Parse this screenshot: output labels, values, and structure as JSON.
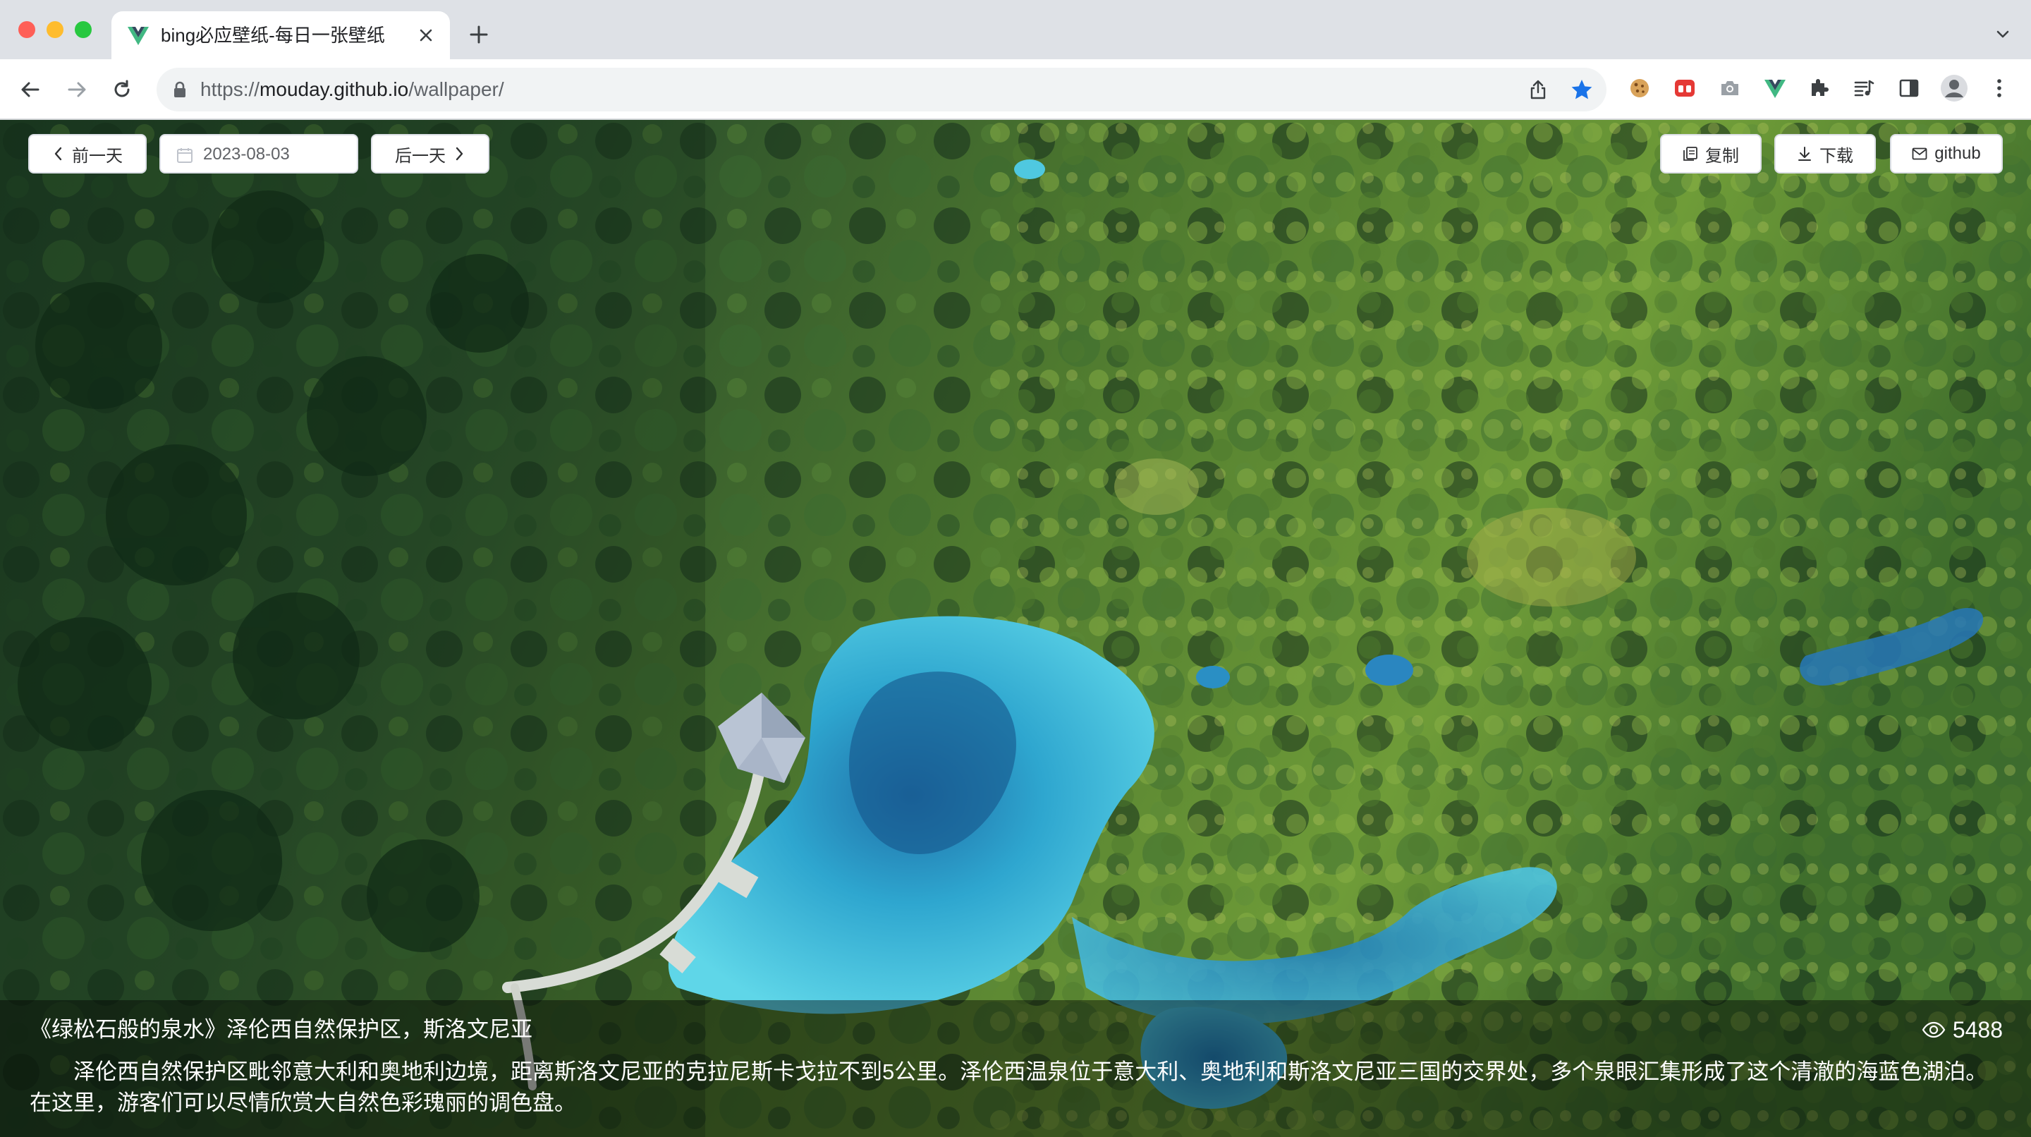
{
  "browser": {
    "tab_title": "bing必应壁纸-每日一张壁纸",
    "url_prefix": "https://",
    "url_host": "mouday.github.io",
    "url_path": "/wallpaper/"
  },
  "controls": {
    "prev_label": "前一天",
    "date_value": "2023-08-03",
    "next_label": "后一天",
    "copy_label": "复制",
    "download_label": "下载",
    "github_label": "github"
  },
  "wallpaper": {
    "title": "《绿松石般的泉水》泽伦西自然保护区，斯洛文尼亚",
    "views": "5488",
    "description": "泽伦西自然保护区毗邻意大利和奥地利边境，距离斯洛文尼亚的克拉尼斯卡戈拉不到5公里。泽伦西温泉位于意大利、奥地利和斯洛文尼亚三国的交界处，多个泉眼汇集形成了这个清澈的海蓝色湖泊。在这里，游客们可以尽情欣赏大自然色彩瑰丽的调色盘。"
  },
  "colors": {
    "accent_star": "#1a73e8",
    "vue_green": "#41b883",
    "vue_dark": "#35495e",
    "lake": "#3cc9e4",
    "forest_dark": "#1f3f24",
    "forest_light": "#7fa83a"
  },
  "icons": {
    "tab_favicon": "vue-logo-icon",
    "lock": "lock-icon",
    "share": "share-icon",
    "star": "bookmark-star-icon",
    "extensions": [
      "cookie-icon",
      "red-extension-icon",
      "camera-icon",
      "vue-devtools-icon",
      "puzzle-icon",
      "reading-list-icon",
      "side-panel-icon",
      "profile-icon",
      "menu-dots-icon"
    ]
  }
}
